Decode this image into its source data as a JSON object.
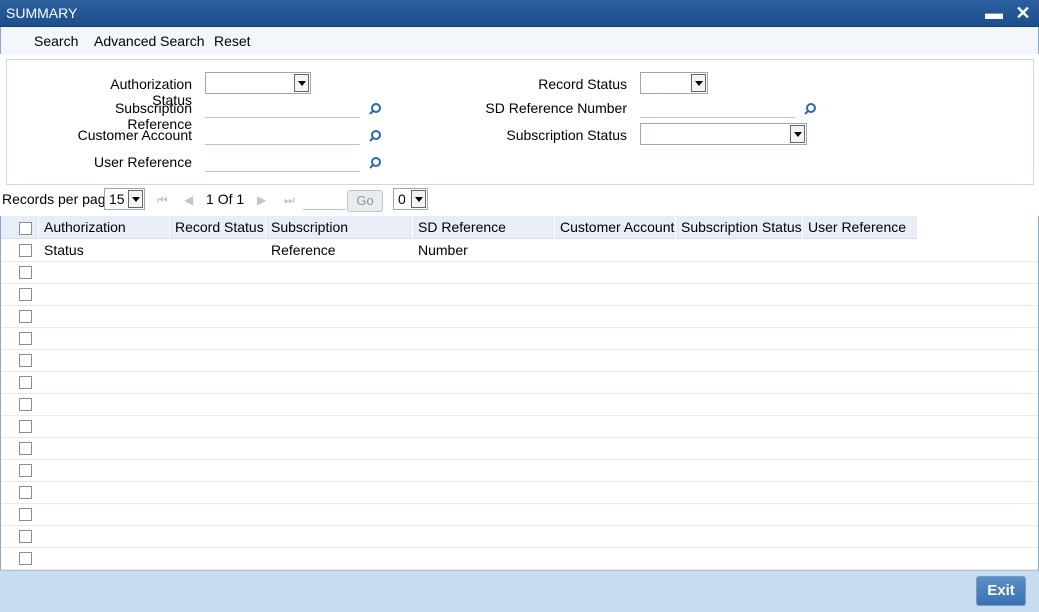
{
  "window": {
    "title": "SUMMARY",
    "minimize_icon": "minimize-icon",
    "close_icon": "close-icon"
  },
  "toolbar": {
    "search_label": "Search",
    "advanced_search_label": "Advanced Search",
    "reset_label": "Reset"
  },
  "criteria": {
    "authorization_status_label": "Authorization Status",
    "subscription_reference_label": "Subscription Reference",
    "customer_account_label": "Customer Account",
    "user_reference_label": "User Reference",
    "record_status_label": "Record Status",
    "sd_reference_number_label": "SD Reference Number",
    "subscription_status_label": "Subscription Status",
    "authorization_status_value": "",
    "record_status_value": "",
    "subscription_status_value": "",
    "subscription_reference_value": "",
    "customer_account_value": "",
    "user_reference_value": "",
    "sd_reference_number_value": ""
  },
  "pager": {
    "records_per_page_label": "Records per page",
    "records_per_page_value": "15",
    "current_page": "1",
    "of_label": "Of",
    "total_pages": "1",
    "go_label": "Go",
    "goto_value": "",
    "export_value": "0"
  },
  "grid": {
    "columns": [
      "Authorization Status",
      "Record Status",
      "Subscription Reference",
      "SD Reference Number",
      "Customer Account",
      "Subscription Status",
      "User Reference"
    ],
    "empty_rows": 15
  },
  "footer": {
    "exit_label": "Exit"
  },
  "colors": {
    "title_bar": "#1d4f8e",
    "footer": "#c7dcf1",
    "header": "#e8eef7",
    "exit_button": "#3a72b3"
  }
}
